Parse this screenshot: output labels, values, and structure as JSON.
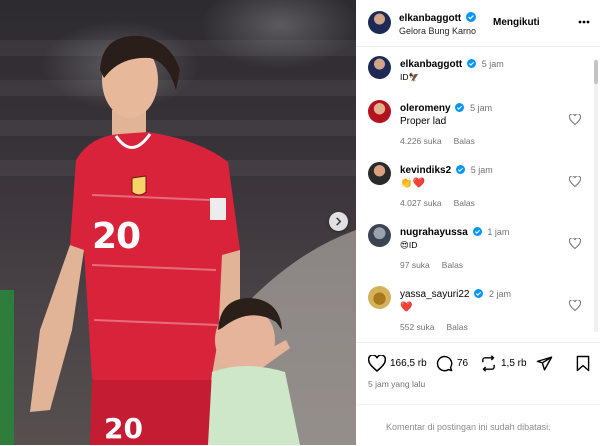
{
  "post_header": {
    "username": "elkanbaggott",
    "location": "Gelora Bung Karno",
    "follow_label": "Mengikuti",
    "more_icon": "more-horizontal-icon"
  },
  "caption": {
    "username": "elkanbaggott",
    "time": "5 jam",
    "text": "ID🦅"
  },
  "comments": [
    {
      "username": "oleromeny",
      "time": "5 jam",
      "text": "Proper lad",
      "likes": "4.226 suka",
      "reply": "Balas"
    },
    {
      "username": "kevindiks2",
      "time": "5 jam",
      "text": "👏❤️",
      "likes": "4.027 suka",
      "reply": "Balas"
    },
    {
      "username": "nugrahayussa",
      "time": "1 jam",
      "text": "😍ID",
      "likes": "97 suka",
      "reply": "Balas"
    },
    {
      "username": "yassa_sayuri22",
      "time": "2 jam",
      "text": "❤️",
      "likes": "552 suka",
      "reply": "Balas"
    }
  ],
  "actions": {
    "likes": "166,5 rb",
    "comments": "76",
    "reposts": "1,5 rb",
    "posted": "5 jam yang lalu"
  },
  "footer": {
    "disabled_text": "Komentar di postingan ini sudah dibatasi."
  },
  "photo": {
    "jersey_number": "20",
    "jersey_color": "#d9233b"
  },
  "colors": {
    "verified": "#0095f6",
    "muted": "#737373",
    "heart_red": "#ed4956"
  }
}
